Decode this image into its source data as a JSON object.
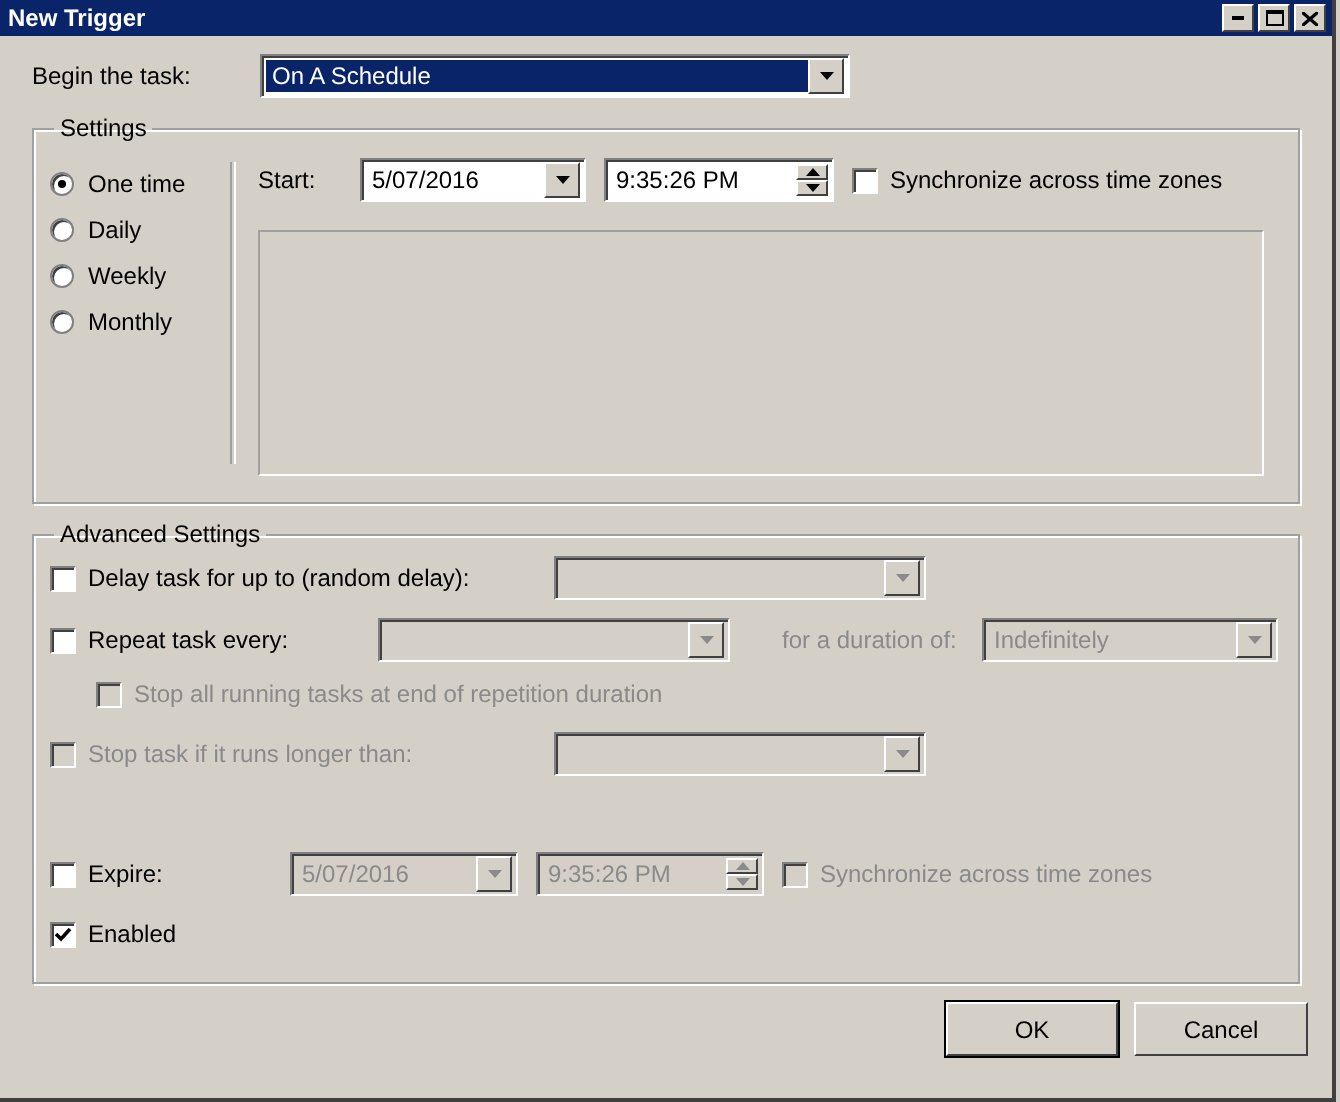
{
  "window": {
    "title": "New Trigger"
  },
  "begin_task": {
    "label": "Begin the task:",
    "value": "On A Schedule"
  },
  "settings": {
    "title": "Settings",
    "schedule": [
      {
        "label": "One time",
        "selected": true
      },
      {
        "label": "Daily",
        "selected": false
      },
      {
        "label": "Weekly",
        "selected": false
      },
      {
        "label": "Monthly",
        "selected": false
      }
    ],
    "start": {
      "label": "Start:",
      "date": "5/07/2016",
      "time": "9:35:26 PM"
    },
    "sync": {
      "label": "Synchronize across time zones",
      "checked": false
    }
  },
  "advanced": {
    "title": "Advanced Settings",
    "delay": {
      "label": "Delay task for up to (random delay):",
      "checked": false,
      "disabled": false
    },
    "repeat": {
      "label": "Repeat task every:",
      "checked": false,
      "disabled": false,
      "duration_label": "for a duration of:",
      "duration_value": "Indefinitely"
    },
    "stop_all": {
      "label": "Stop all running tasks at end of repetition duration",
      "checked": false,
      "disabled": true
    },
    "stop_if": {
      "label": "Stop task if it runs longer than:",
      "checked": false,
      "disabled": true
    },
    "expire": {
      "label": "Expire:",
      "checked": false,
      "disabled": false,
      "date": "5/07/2016",
      "time": "9:35:26 PM",
      "sync_label": "Synchronize across time zones",
      "sync_checked": false
    },
    "enabled": {
      "label": "Enabled",
      "checked": true,
      "disabled": false
    }
  },
  "buttons": [
    {
      "label": "OK",
      "default": true
    },
    {
      "label": "Cancel",
      "default": false
    }
  ]
}
